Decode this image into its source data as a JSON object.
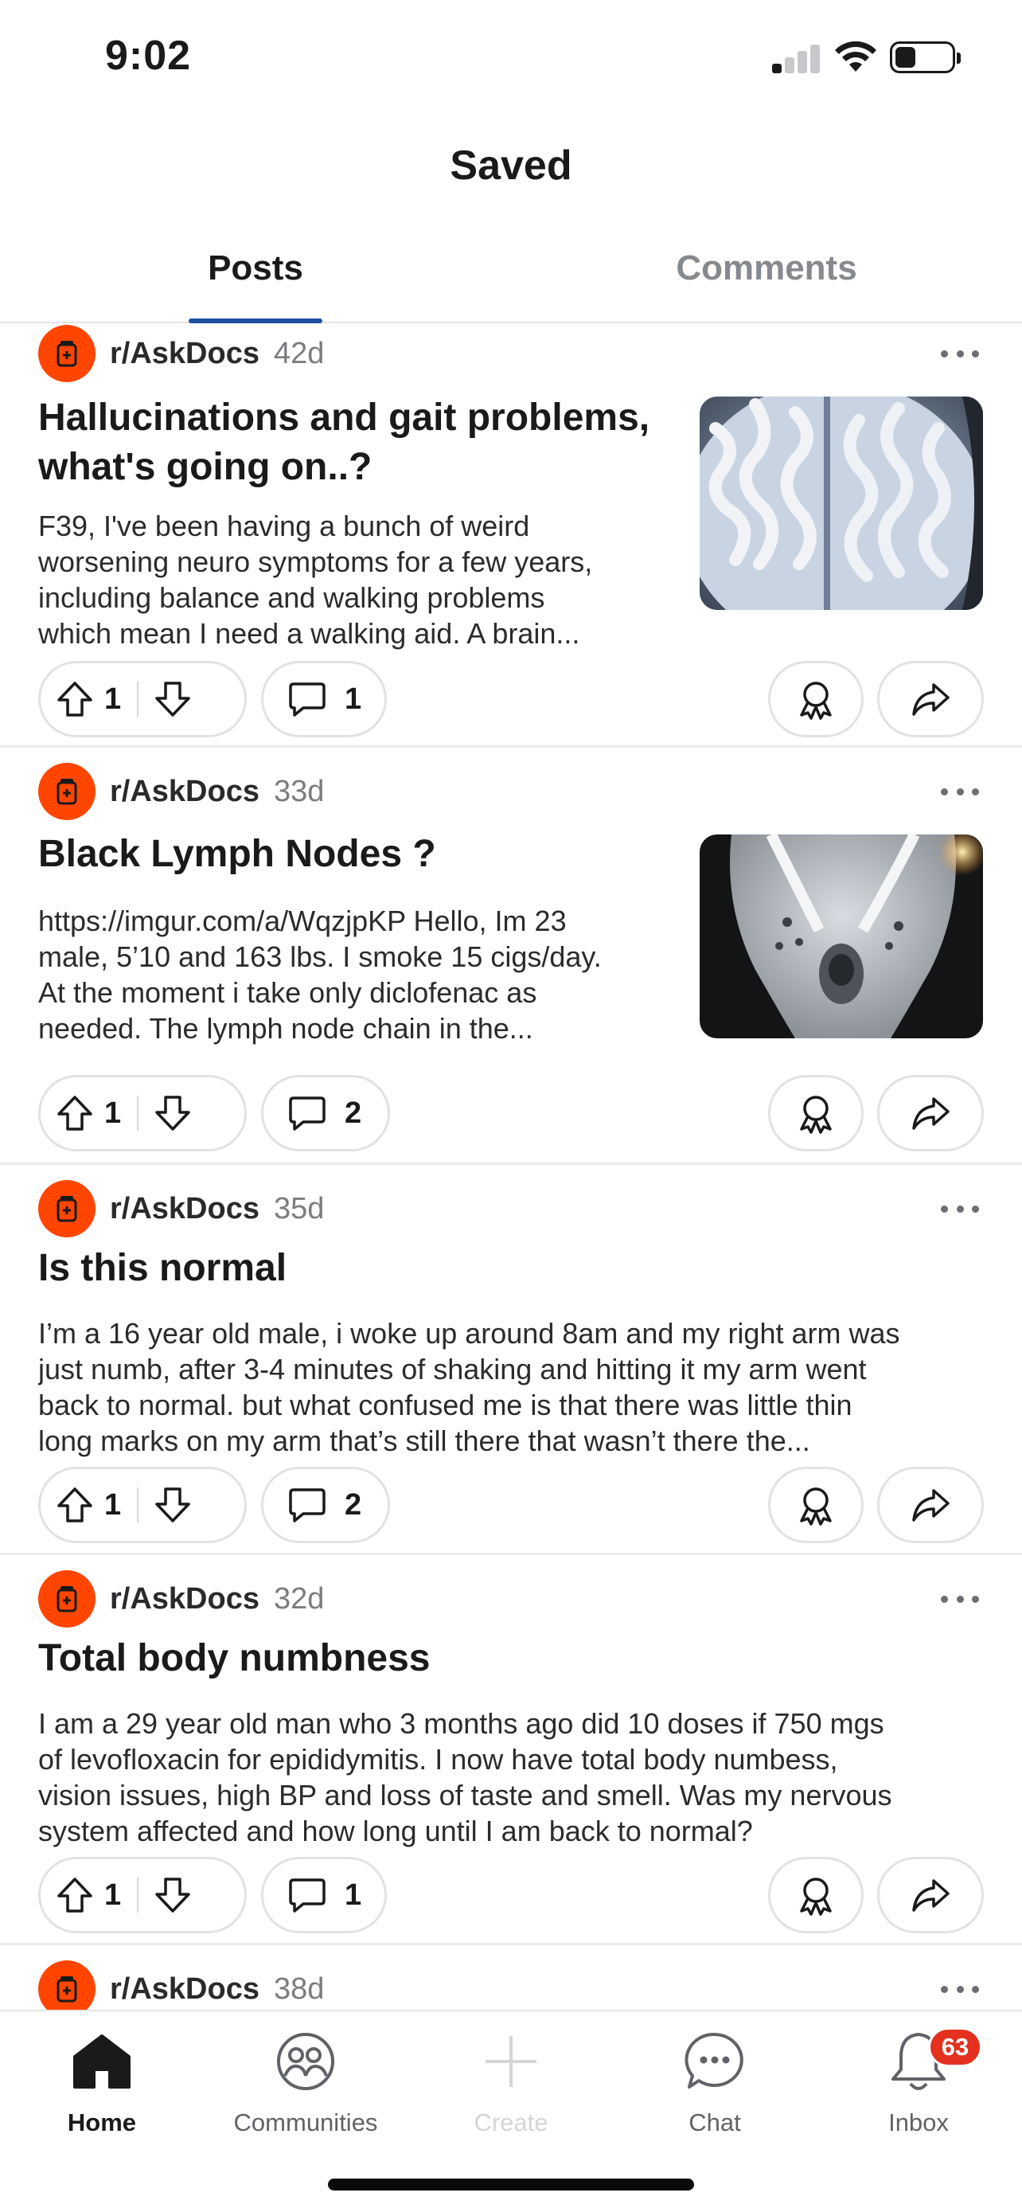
{
  "status_bar": {
    "time": "9:02",
    "battery_level": 0.35
  },
  "header": {
    "title": "Saved"
  },
  "tabs": [
    {
      "label": "Posts",
      "active": true
    },
    {
      "label": "Comments",
      "active": false
    }
  ],
  "colors": {
    "accent": "#1c4fa0",
    "subreddit_icon": "#ff4500",
    "badge": "#e3301f"
  },
  "posts": [
    {
      "subreddit": "r/AskDocs",
      "age": "42d",
      "title_lines": [
        "Hallucinations and gait problems,",
        "what's going on..?"
      ],
      "body_lines": [
        "F39, I've been having a bunch of weird",
        "worsening neuro symptoms for a few years,",
        "including balance and walking problems",
        "which mean I need a walking aid. A brain..."
      ],
      "upvotes": "1",
      "comments": "1",
      "thumbnail": "brain-mri-image"
    },
    {
      "subreddit": "r/AskDocs",
      "age": "33d",
      "title_lines": [
        "Black Lymph Nodes ?"
      ],
      "body_lines": [
        "https://imgur.com/a/WqzjpKP Hello, Im 23",
        "male, 5’10 and 163 lbs. I smoke 15 cigs/day.",
        "At the moment i take only diclofenac as",
        "needed. The lymph node chain in the..."
      ],
      "upvotes": "1",
      "comments": "2",
      "thumbnail": "lymph-node-scan-image"
    },
    {
      "subreddit": "r/AskDocs",
      "age": "35d",
      "title_lines": [
        "Is this normal"
      ],
      "body_lines": [
        "I’m a 16 year old male, i woke up around 8am and my right arm was",
        "just numb, after 3-4 minutes of shaking and hitting it my arm went",
        "back to normal. but what confused me is that there was little thin",
        "long marks on my arm that’s still there that wasn’t there the..."
      ],
      "upvotes": "1",
      "comments": "2"
    },
    {
      "subreddit": "r/AskDocs",
      "age": "32d",
      "title_lines": [
        "Total body numbness"
      ],
      "body_lines": [
        "I am a 29 year old man who 3 months ago did 10 doses if 750 mgs",
        "of levofloxacin for epididymitis. I now have total body numbess,",
        "vision issues, high BP and loss of taste and smell. Was my nervous",
        "system affected and how long until I am back to normal?"
      ],
      "upvotes": "1",
      "comments": "1"
    },
    {
      "subreddit": "r/AskDocs",
      "age": "38d"
    }
  ],
  "bottom_nav": [
    {
      "label": "Home",
      "icon": "home-icon",
      "active": true
    },
    {
      "label": "Communities",
      "icon": "communities-icon"
    },
    {
      "label": "Create",
      "icon": "plus-icon",
      "disabled": true
    },
    {
      "label": "Chat",
      "icon": "chat-icon"
    },
    {
      "label": "Inbox",
      "icon": "bell-icon",
      "badge": "63"
    }
  ]
}
